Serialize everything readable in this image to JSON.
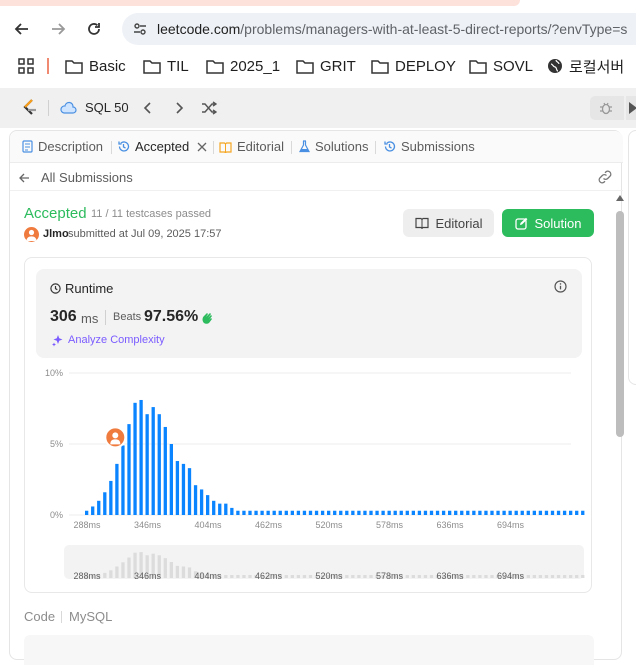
{
  "browser": {
    "url_host": "leetcode.com",
    "url_path": "/problems/managers-with-at-least-5-direct-reports/?envType=s",
    "bookmarks": [
      "Basic",
      "TIL",
      "2025_1",
      "GRIT",
      "DEPLOY",
      "SOVL",
      "로컬서버"
    ]
  },
  "lc_header": {
    "study_plan": "SQL 50"
  },
  "tabs": [
    {
      "label": "Description"
    },
    {
      "label": "Accepted"
    },
    {
      "label": "Editorial"
    },
    {
      "label": "Solutions"
    },
    {
      "label": "Submissions"
    }
  ],
  "subbar": {
    "back_label": "All Submissions"
  },
  "result": {
    "status": "Accepted",
    "testcases": "11 / 11 testcases passed",
    "user": "Jlmo",
    "submitted": "submitted at Jul 09, 2025 17:57",
    "editorial_btn": "Editorial",
    "solution_btn": "Solution"
  },
  "runtime": {
    "title": "Runtime",
    "value": "306",
    "unit": "ms",
    "beats_label": "Beats",
    "beats_value": "97.56%",
    "analyze": "Analyze Complexity"
  },
  "code": {
    "label": "Code",
    "lang": "MySQL"
  },
  "colors": {
    "accent_green": "#2cbb5d",
    "bar_blue": "#0a84ff",
    "purple": "#7b5cff",
    "avatar_orange": "#f07b3f"
  },
  "chart_data": {
    "type": "bar",
    "y_ticks": [
      "10%",
      "5%",
      "0%"
    ],
    "ylim": [
      0,
      10
    ],
    "x_ticks": [
      "288ms",
      "346ms",
      "404ms",
      "462ms",
      "520ms",
      "578ms",
      "636ms",
      "694ms"
    ],
    "values": [
      0.3,
      0.6,
      1.0,
      1.6,
      2.4,
      3.6,
      4.9,
      6.4,
      7.9,
      8.1,
      7.1,
      7.6,
      7.1,
      6.2,
      5.0,
      3.8,
      3.6,
      3.3,
      2.1,
      1.8,
      1.4,
      1.0,
      0.8,
      0.8,
      0.5,
      0.3,
      0.3,
      0.3,
      0.3,
      0.3,
      0.3,
      0.3,
      0.3,
      0.3,
      0.3,
      0.3,
      0.3,
      0.3,
      0.3,
      0.3,
      0.3,
      0.3,
      0.3,
      0.3,
      0.3,
      0.3,
      0.3,
      0.3,
      0.3,
      0.3,
      0.3,
      0.3,
      0.3,
      0.3,
      0.3,
      0.3,
      0.3,
      0.3,
      0.3,
      0.3,
      0.3,
      0.3,
      0.3,
      0.3,
      0.3,
      0.3,
      0.3,
      0.3,
      0.3,
      0.3,
      0.3,
      0.3,
      0.3,
      0.3,
      0.3,
      0.3,
      0.3,
      0.3,
      0.3,
      0.3,
      0.3,
      0.3,
      0.3
    ],
    "user_bar_index": 6
  }
}
